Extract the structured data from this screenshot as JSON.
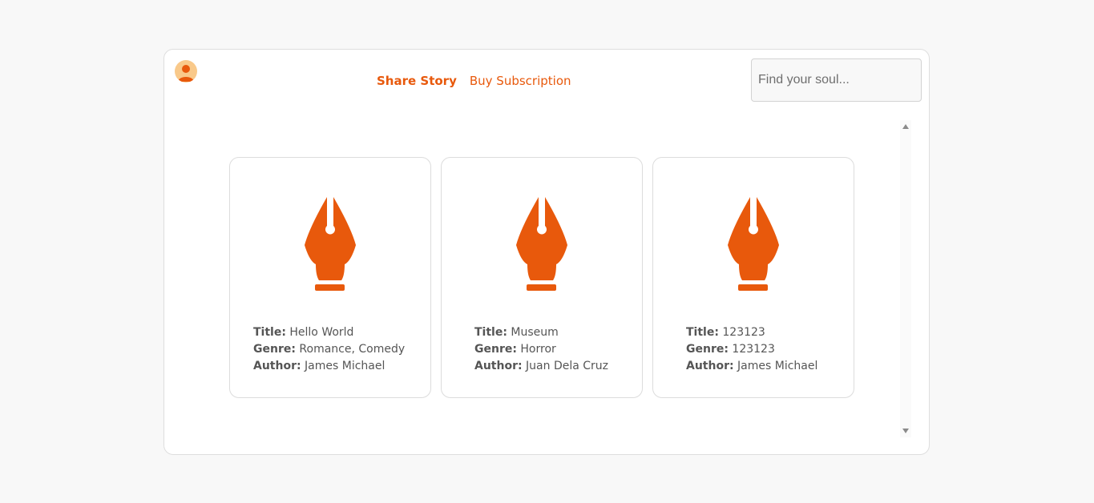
{
  "colors": {
    "accent": "#e8590c",
    "avatar_bg": "#f9c98a",
    "text": "#555555"
  },
  "nav": {
    "share_story": "Share Story",
    "buy_subscription": "Buy Subscription"
  },
  "search": {
    "placeholder": "Find your soul..."
  },
  "labels": {
    "title": "Title:",
    "genre": "Genre:",
    "author": "Author:"
  },
  "stories": [
    {
      "icon": "fountain-pen-nib-icon",
      "title": "Hello World",
      "genre": "Romance, Comedy",
      "author": "James Michael"
    },
    {
      "icon": "fountain-pen-nib-icon",
      "title": "Museum",
      "genre": "Horror",
      "author": "Juan Dela Cruz"
    },
    {
      "icon": "fountain-pen-nib-icon",
      "title": "123123",
      "genre": "123123",
      "author": "James Michael"
    }
  ]
}
